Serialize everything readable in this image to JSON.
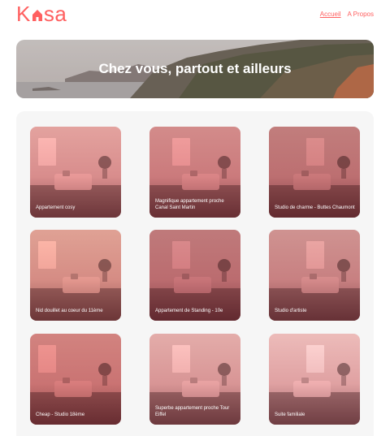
{
  "header": {
    "logo_before": "K",
    "logo_after": "sa",
    "nav": [
      {
        "label": "Accueil",
        "active": true
      },
      {
        "label": "A Propos",
        "active": false
      }
    ]
  },
  "banner": {
    "title": "Chez vous, partout et ailleurs"
  },
  "colors": {
    "brand": "#ff6060",
    "gallery_background": "#f6f6f6"
  },
  "listings": [
    {
      "title": "Appartement cosy",
      "tint": "#c99692"
    },
    {
      "title": "Magnifique appartement proche Canal Saint Martin",
      "tint": "#b9807f"
    },
    {
      "title": "Studio de charme - Buttes Chaumont",
      "tint": "#a87271"
    },
    {
      "title": "Nid douillet au coeur du 11ème",
      "tint": "#c59589"
    },
    {
      "title": "Appartement de Standing - 10e",
      "tint": "#a66f70"
    },
    {
      "title": "Studio d'artiste",
      "tint": "#b58785"
    },
    {
      "title": "Cheap - Studio 18ème",
      "tint": "#b87874"
    },
    {
      "title": "Superbe appartement proche Tour Eiffel",
      "tint": "#c9a09d"
    },
    {
      "title": "Suite familiale",
      "tint": "#d2aeac"
    }
  ]
}
